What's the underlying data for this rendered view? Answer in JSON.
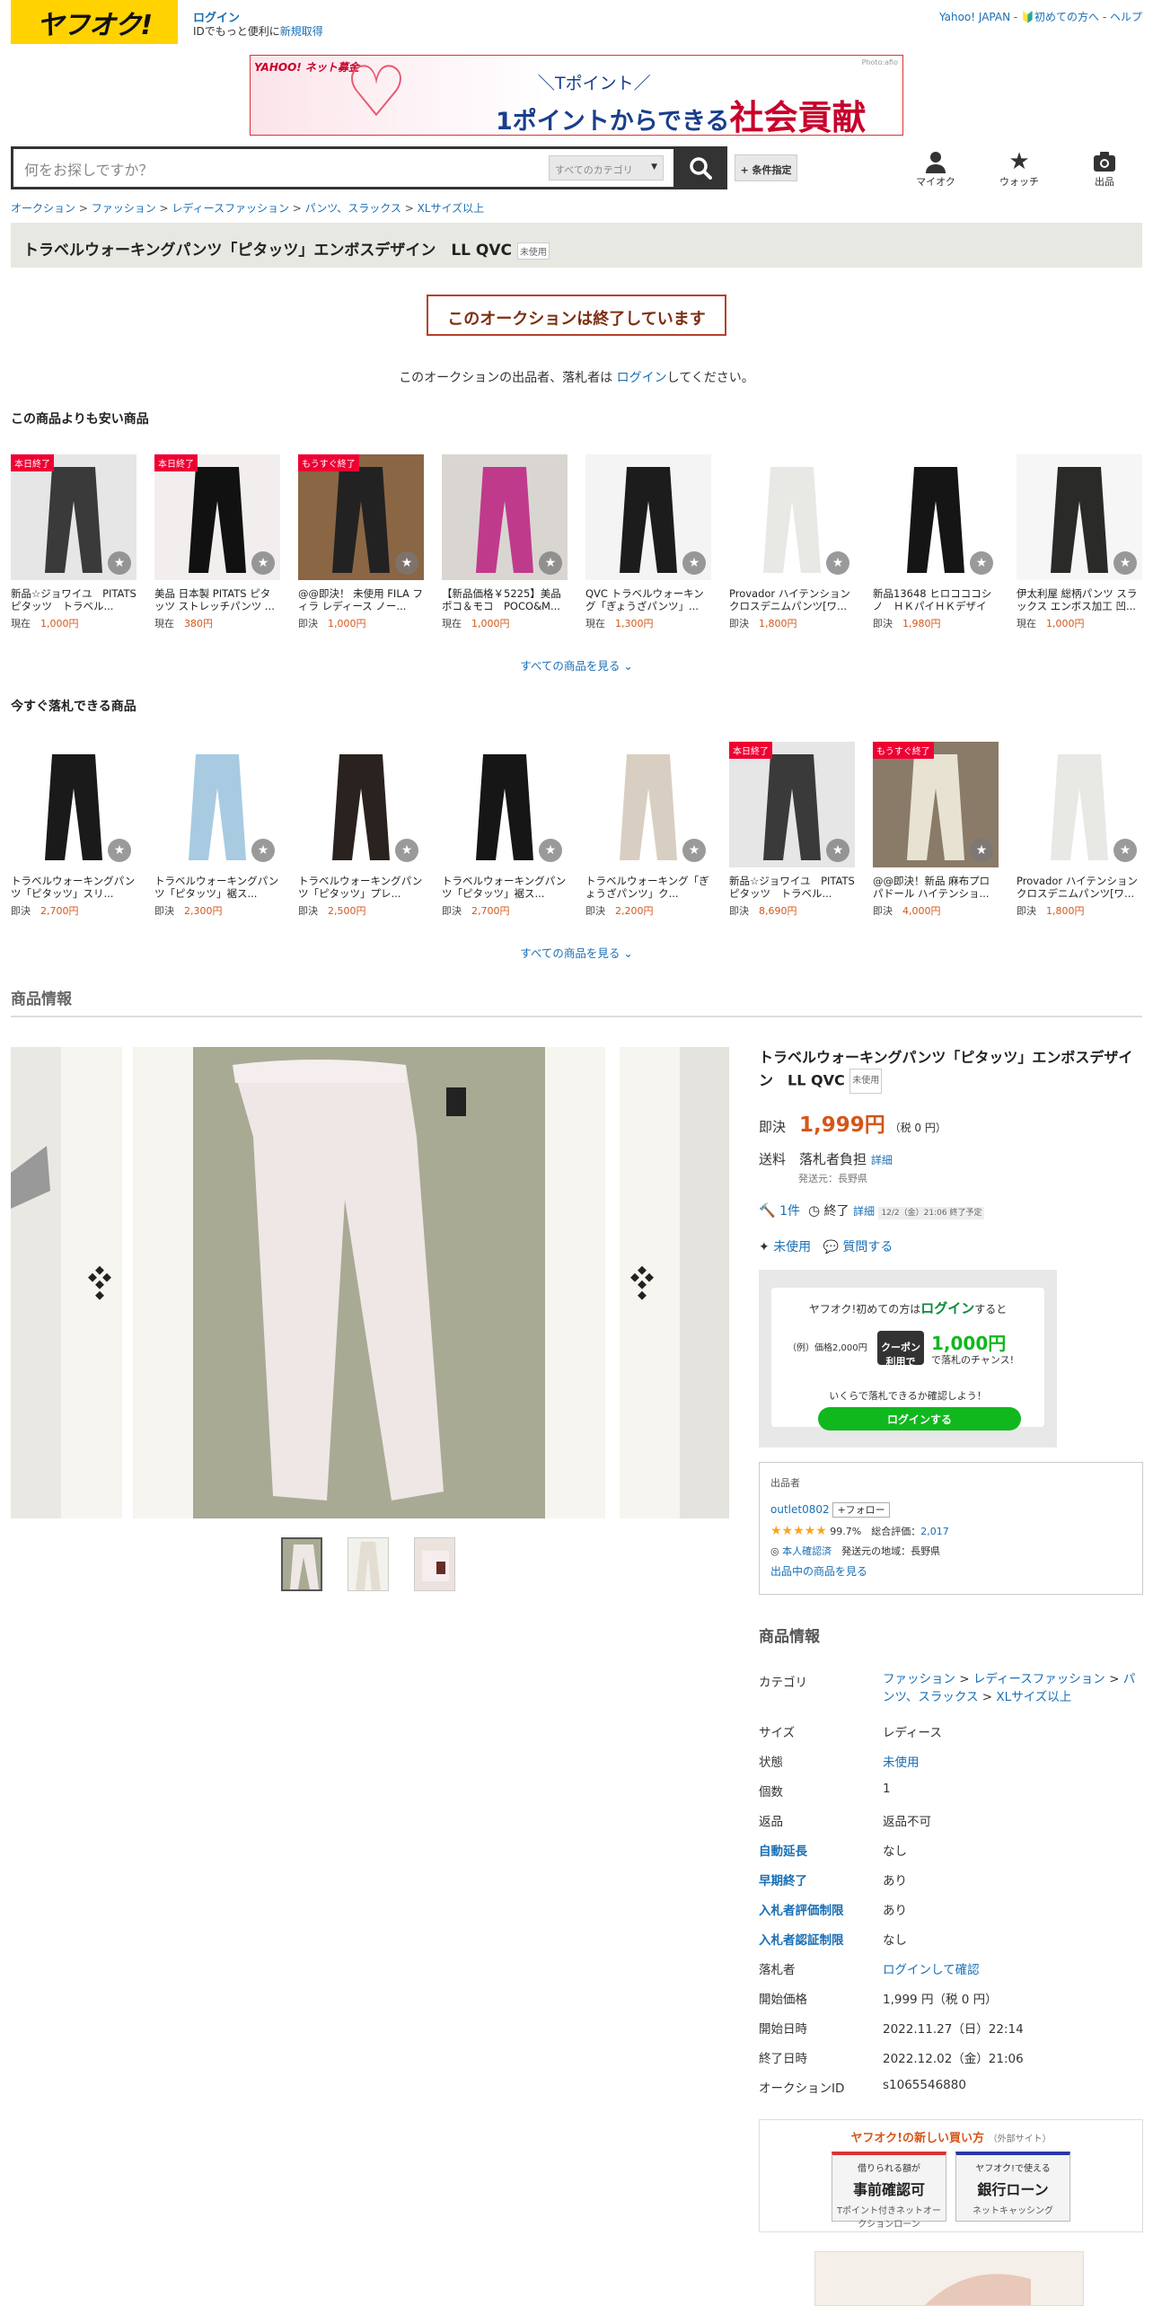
{
  "header": {
    "logo": "ヤフオク!",
    "login": "ログイン",
    "login_sub_prefix": "IDでもっと便利に",
    "register": "新規取得",
    "yahoo_japan": "Yahoo! JAPAN",
    "beginner": "初めての方へ",
    "help": "ヘルプ"
  },
  "banner": {
    "brand": "YAHOO! ネット募金",
    "line1": "＼Tポイント／",
    "line2": "1ポイントからできる",
    "line3": "社会貢献",
    "credit": "Photo:afio"
  },
  "search": {
    "placeholder": "何をお探しですか？",
    "category": "すべてのカテゴリ",
    "condition": "+ 条件指定",
    "my_auction": "マイオク",
    "watch": "ウォッチ",
    "sell": "出品"
  },
  "breadcrumb": [
    "オークション",
    "ファッション",
    "レディースファッション",
    "パンツ、スラックス",
    "XLサイズ以上"
  ],
  "title": "トラベルウォーキングパンツ「ピタッツ」エンボスデザイン　LL QVC",
  "condition_tag": "未使用",
  "ended_notice": "このオークションは終了しています",
  "login_notice": {
    "pre": "このオークションの出品者、落札者は ",
    "link": "ログイン",
    "post": "してください。"
  },
  "cheaper": {
    "heading": "この商品よりも安い商品",
    "see_all": "すべての商品を見る",
    "items": [
      {
        "badge": "本日終了",
        "name": "新品☆ジョワイユ　PITATS ピタッツ　トラベル...",
        "ptype": "現在",
        "price": "1,000円",
        "color": "#3a3a3a",
        "bg": "#e6e6e6"
      },
      {
        "badge": "本日終了",
        "name": "美品 日本製 PITATS ピタッツ ストレッチパンツ ...",
        "ptype": "現在",
        "price": "380円",
        "color": "#111",
        "bg": "#f2eeee"
      },
      {
        "badge": "もうすぐ終了",
        "name": "@@即決！ 未使用 FILA フィラ レディース ノー...",
        "ptype": "即決",
        "price": "1,000円",
        "color": "#222",
        "bg": "#8a6644"
      },
      {
        "badge": "",
        "name": "【新品価格￥5225】美品 ポコ＆モコ　POCO&M...",
        "ptype": "現在",
        "price": "1,000円",
        "color": "#c03a8c",
        "bg": "#d9d6d2"
      },
      {
        "badge": "",
        "name": "QVC トラベルウォーキング「ぎょうざパンツ」...",
        "ptype": "現在",
        "price": "1,300円",
        "color": "#1c1c1c",
        "bg": "#f4f4f4"
      },
      {
        "badge": "",
        "name": "Provador ハイテンション クロスデニムパンツ[ワ...",
        "ptype": "即決",
        "price": "1,800円",
        "color": "#e8e8e4",
        "bg": "#ffffff"
      },
      {
        "badge": "",
        "name": "新品13648 ヒロコココシノ　ＨＫパイＨＫデザイン...",
        "ptype": "即決",
        "price": "1,980円",
        "color": "#151515",
        "bg": "#ffffff"
      },
      {
        "badge": "",
        "name": "伊太利屋 総柄パンツ スラックス エンボス加工 凹...",
        "ptype": "現在",
        "price": "1,000円",
        "color": "#2a2a28",
        "bg": "#f6f6f6"
      }
    ]
  },
  "buynow": {
    "heading": "今すぐ落札できる商品",
    "see_all": "すべての商品を見る",
    "items": [
      {
        "badge": "",
        "name": "トラベルウォーキングパンツ「ピタッツ」スリ...",
        "ptype": "即決",
        "price": "2,700円",
        "color": "#1a1a1a",
        "bg": "#ffffff"
      },
      {
        "badge": "",
        "name": "トラベルウォーキングパンツ「ピタッツ」裾ス...",
        "ptype": "即決",
        "price": "2,300円",
        "color": "#a8cbe2",
        "bg": "#ffffff"
      },
      {
        "badge": "",
        "name": "トラベルウォーキングパンツ「ピタッツ」プレ...",
        "ptype": "即決",
        "price": "2,500円",
        "color": "#2a221e",
        "bg": "#ffffff"
      },
      {
        "badge": "",
        "name": "トラベルウォーキングパンツ「ピタッツ」裾ス...",
        "ptype": "即決",
        "price": "2,700円",
        "color": "#161616",
        "bg": "#ffffff"
      },
      {
        "badge": "",
        "name": "トラベルウォーキング「ぎょうざパンツ」ク...",
        "ptype": "即決",
        "price": "2,200円",
        "color": "#d8cfc2",
        "bg": "#ffffff"
      },
      {
        "badge": "本日終了",
        "name": "新品☆ジョワイユ　PITATS ピタッツ　トラベル...",
        "ptype": "即決",
        "price": "8,690円",
        "color": "#3a3a3a",
        "bg": "#e6e6e6"
      },
      {
        "badge": "もうすぐ終了",
        "name": "@@即決！新品 麻布プロパドール ハイテンショ...",
        "ptype": "即決",
        "price": "4,000円",
        "color": "#e8e2d2",
        "bg": "#8a7a68"
      },
      {
        "badge": "",
        "name": "Provador ハイテンション クロスデニムパンツ[ワ...",
        "ptype": "即決",
        "price": "1,800円",
        "color": "#e8e8e4",
        "bg": "#ffffff"
      }
    ]
  },
  "product_info_heading": "商品情報",
  "product": {
    "title": "トラベルウォーキングパンツ「ピタッツ」エンボスデザイン　LL QVC",
    "tag": "未使用",
    "buynow_label": "即決",
    "price": "1,999円",
    "tax": "（税 0 円）",
    "shipping_label": "送料",
    "shipping": "落札者負担",
    "shipping_detail": "詳細",
    "ship_from": "発送元：長野県",
    "bids": "1件",
    "status": "終了",
    "status_detail": "詳細",
    "end_note": "12/2（金）21:06 終了予定",
    "condition": "未使用",
    "ask": "質問する"
  },
  "promo": {
    "line1_pre": "ヤフオク!初めての方は",
    "line1_link": "ログイン",
    "line1_post": "すると",
    "example": "（例）価格2,000円",
    "coupon": "クーポン利用で",
    "amount": "1,000円",
    "suffix": "で落札のチャンス!",
    "check": "いくらで落札できるか確認しよう！",
    "button": "ログインする"
  },
  "seller": {
    "label": "出品者",
    "name": "outlet0802",
    "follow": "+フォロー",
    "rating_pct": "99.7%",
    "total_label": "総合評価：",
    "total": "2,017",
    "verified": "本人確認済",
    "region": "発送元の地域：長野県",
    "listings": "出品中の商品を見る"
  },
  "spec_heading": "商品情報",
  "spec": {
    "category_label": "カテゴリ",
    "category": [
      "ファッション",
      "レディースファッション",
      "パンツ、スラックス",
      "XLサイズ以上"
    ],
    "rows": [
      {
        "k": "サイズ",
        "v": "レディース",
        "kl": false,
        "vl": false
      },
      {
        "k": "状態",
        "v": "未使用",
        "kl": false,
        "vl": true
      },
      {
        "k": "個数",
        "v": "1",
        "kl": false,
        "vl": false
      },
      {
        "k": "返品",
        "v": "返品不可",
        "kl": false,
        "vl": false
      },
      {
        "k": "自動延長",
        "v": "なし",
        "kl": true,
        "vl": false
      },
      {
        "k": "早期終了",
        "v": "あり",
        "kl": true,
        "vl": false
      },
      {
        "k": "入札者評価制限",
        "v": "あり",
        "kl": true,
        "vl": false
      },
      {
        "k": "入札者認証制限",
        "v": "なし",
        "kl": true,
        "vl": false
      },
      {
        "k": "落札者",
        "v": "ログインして確認",
        "kl": false,
        "vl": true
      },
      {
        "k": "開始価格",
        "v": "1,999 円（税 0 円）",
        "kl": false,
        "vl": false
      },
      {
        "k": "開始日時",
        "v": "2022.11.27（日）22:14",
        "kl": false,
        "vl": false
      },
      {
        "k": "終了日時",
        "v": "2022.12.02（金）21:06",
        "kl": false,
        "vl": false
      },
      {
        "k": "オークションID",
        "v": "s1065546880",
        "kl": false,
        "vl": false
      }
    ]
  },
  "newbuy": {
    "title": "ヤフオク!の新しい買い方",
    "ext": "（外部サイト）",
    "card1_top": "借りられる額が",
    "card1_big": "事前確認可",
    "card1_sub": "Tポイント付きネットオークションローン",
    "card2_top": "ヤフオク!で使える",
    "card2_big": "銀行ローン",
    "card2_sub": "ネットキャッシング"
  }
}
